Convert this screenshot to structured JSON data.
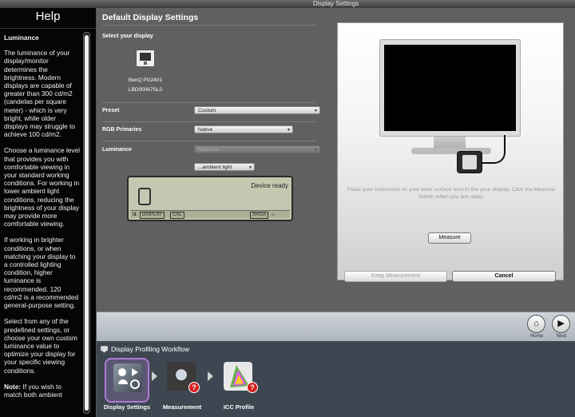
{
  "window": {
    "title": "Display Settings"
  },
  "help": {
    "title": "Help",
    "heading": "Luminance",
    "paragraphs": [
      "The luminance of your display/monitor determines the brightness. Modern displays are capable of greater than 300 cd/m2 (candelas per square meter) - which is very bright, while older displays may struggle to achieve 100 cd/m2.",
      "Choose a luminance level that provides you with comfortable viewing in your standard working conditions. For working in lower ambient light conditions, reducing the brightness of your display may provide more comfortable viewing.",
      "If working in brighter conditions, or when matching your display to a controlled lighting condition, higher luminance is recommended. 120 cd/m2 is a recommended general-purpose setting.",
      "Select from any of the predefined settings, or choose your own custom luminance value to optimize your display for your specific viewing conditions."
    ],
    "note_label": "Note:",
    "note_text": " If you wish to match both ambient"
  },
  "settings": {
    "section_title": "Default Display Settings",
    "select_display_label": "Select your display",
    "display_name": "BenQ PG2401",
    "display_serial": "LBD00067SL0",
    "preset_label": "Preset",
    "preset_value": "Custom",
    "rgb_label": "RGB Primaries",
    "rgb_value": "Native",
    "luminance_label": "Luminance",
    "luminance_value": "Measure...",
    "ambient_value": "...ambient light"
  },
  "device": {
    "status": "Device ready",
    "strip": {
      "logo": "i1",
      "display": "DISPLAY",
      "cal": "CAL",
      "xrga": "XRGA"
    }
  },
  "preview": {
    "hint": "Place your instrument on your work surface next to the your display. Click the Measure button when you are ready",
    "measure_button": "Measure",
    "keep_button": "Keep Measurement",
    "cancel_button": "Cancel"
  },
  "nav": {
    "home_label": "Home",
    "next_label": "Next"
  },
  "workflow": {
    "title": "Display Profiling Workflow",
    "steps": [
      {
        "label": "Display Settings"
      },
      {
        "label": "Measurement"
      },
      {
        "label": "ICC Profile"
      }
    ]
  }
}
